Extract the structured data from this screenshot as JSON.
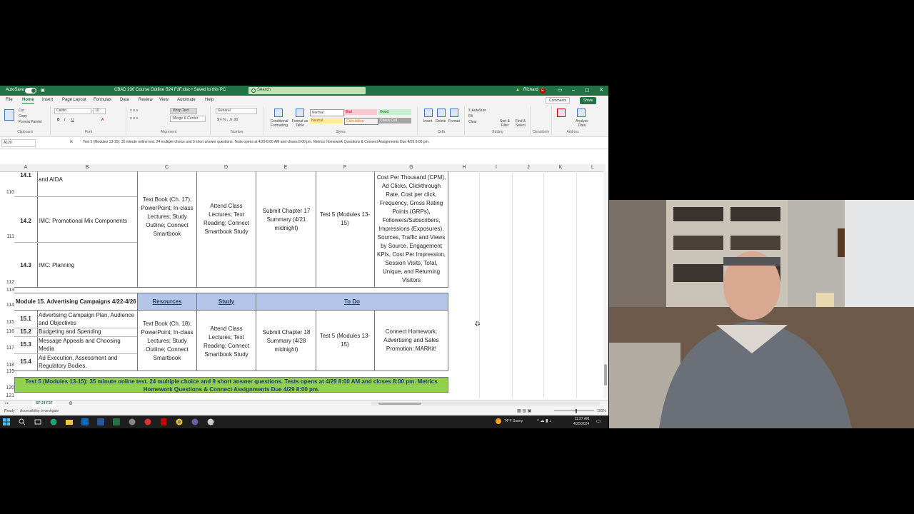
{
  "titlebar": {
    "autosave": "AutoSave",
    "filename": "CBAD 230 Course Outline S24 F2F.xlsx • Saved to this PC",
    "search": "Search",
    "user": "Richard",
    "avatar_initial": "R"
  },
  "menu": {
    "tabs": [
      "File",
      "Home",
      "Insert",
      "Page Layout",
      "Formulas",
      "Data",
      "Review",
      "View",
      "Automate",
      "Help"
    ],
    "comments": "Comments",
    "share": "Share"
  },
  "ribbon": {
    "clipboard": {
      "cut": "Cut",
      "copy": "Copy",
      "format_painter": "Format Painter",
      "label": "Clipboard"
    },
    "font": {
      "name": "Calibri",
      "size": "10",
      "label": "Font"
    },
    "alignment": {
      "wrap": "Wrap Text",
      "merge": "Merge & Center",
      "label": "Alignment"
    },
    "number": {
      "format": "General",
      "label": "Number"
    },
    "styles": {
      "conditional": "Conditional Formatting",
      "format_table": "Format as Table",
      "normal": "Normal",
      "bad": "Bad",
      "good": "Good",
      "neutral": "Neutral",
      "calculation": "Calculation",
      "check_cell": "Check Cell",
      "label": "Styles"
    },
    "cells": {
      "insert": "Insert",
      "delete": "Delete",
      "format": "Format",
      "label": "Cells"
    },
    "editing": {
      "autosum": "AutoSum",
      "fill": "Fill",
      "clear": "Clear",
      "sort": "Sort & Filter",
      "find": "Find & Select",
      "label": "Editing"
    },
    "sensitivity": {
      "label": "Sensitivity"
    },
    "addins": {
      "label": "Add-ins",
      "analyze": "Analyze Data"
    }
  },
  "formula_bar": {
    "cell_ref": "A120",
    "fx": "fx",
    "content": "Test 5 (Modules 13-15): 35 minute online test. 24 multiple choice and 9 short answer questions. Tests opens at 4/29 8:00 AM and closes 8:00 pm. Metrics Homework Questions & Connect Assignments  Due 4/29 8:00 pm."
  },
  "columns": [
    "A",
    "B",
    "C",
    "D",
    "E",
    "F",
    "G",
    "H",
    "I",
    "J",
    "K",
    "L"
  ],
  "rows": [
    "110",
    "111",
    "112",
    "113",
    "114",
    "115",
    "116",
    "117",
    "118",
    "119",
    "120",
    "121"
  ],
  "sheet": {
    "r141": {
      "num": "14.1",
      "text": "and AIDA"
    },
    "r142": {
      "num": "14.2",
      "text": "IMC: Promotional Mix Components"
    },
    "r143": {
      "num": "14.3",
      "text": "IMC: Planning"
    },
    "resources14": "Text Book (Ch. 17); PowerPoint; In-class Lectures; Study Outline; Connect Smartbook",
    "study14": "Attend Class Lectures; Text Reading; Connect Smartbook Study",
    "todo14_e": "Submit Chapter 17 Summary (4/21 midnight)",
    "todo14_f": "Test 5 (Modules 13-15)",
    "todo14_g": "Cost Per Thousand (CPM), Ad Clicks, Clickthrough Rate, Cost per click, Frequency, Gross Rating Points (GRPs), Followers/Subscribers, Impressions (Exposures), Sources, Traffic and Views by Source, Engagement KPIs, Cost Per Impression, Session Visits, Total, Unique, and Returning Visitors",
    "module15": "Module 15. Advertising Campaigns 4/22-4/26",
    "hdr_resources": "Resources",
    "hdr_study": "Study",
    "hdr_todo": "To Do",
    "r151": {
      "num": "15.1",
      "text": "Advertising Campaign Plan, Audience and Objectives"
    },
    "r152": {
      "num": "15.2",
      "text": "Budgeting and Spending"
    },
    "r153": {
      "num": "15.3",
      "text": "Message Appeals and Choosing Media"
    },
    "r154": {
      "num": "15.4",
      "text": "Ad Execution, Assessment and Regulatory Bodies."
    },
    "resources15": "Text Book (Ch. 18); PowerPoint; In-class Lectures; Study Outline; Connect Smartbook",
    "study15": "Attend Class Lectures; Text Reading; Connect Smartbook Study",
    "todo15_e": "Submit Chapter 18 Summary (4/28 midnight)",
    "todo15_f": "Test 5 (Modules 13-15)",
    "todo15_g": "Connect Homework: Advertising and Sales Promotion: MARKit!",
    "test5": "Test 5 (Modules 13-15): 35 minute online test. 24 multiple choice and 9 short answer questions. Tests opens at 4/29 8:00 AM and closes 8:00 pm. Metrics Homework Questions & Connect Assignments  Due 4/29 8:00 pm."
  },
  "sheet_tab": "SP 24 F2F",
  "status": {
    "ready": "Ready",
    "accessibility": "Accessibility: Investigate",
    "zoom": "100%"
  },
  "taskbar": {
    "weather": "74°F  Sunny",
    "time": "11:37 AM",
    "date": "4/25/2024"
  },
  "colors": {
    "excel_green": "#217346",
    "header_blue": "#b4c6e7",
    "highlight_green": "#92d050"
  }
}
